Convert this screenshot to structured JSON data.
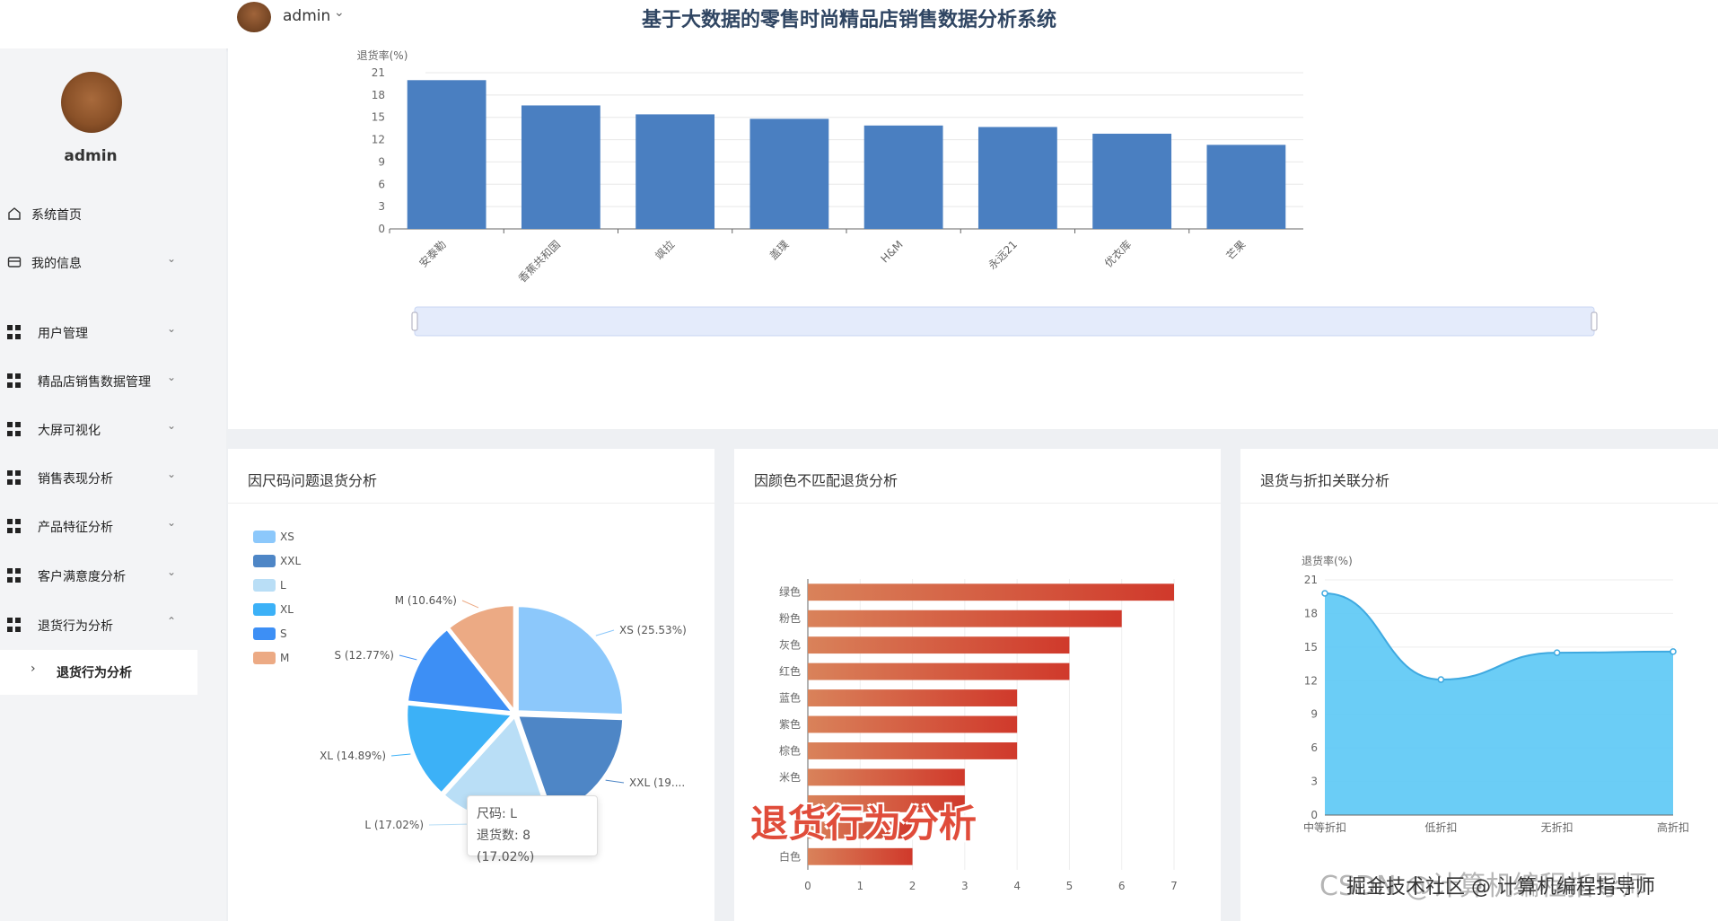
{
  "header": {
    "username": "admin",
    "title": "基于大数据的零售时尚精品店销售数据分析系统"
  },
  "sidebar": {
    "username": "admin",
    "items": [
      {
        "label": "系统首页",
        "icon": "home-icon"
      },
      {
        "label": "我的信息",
        "icon": "card-icon"
      },
      {
        "label": "用户管理",
        "icon": "grid-icon"
      },
      {
        "label": "精品店销售数据管理",
        "icon": "grid-icon"
      },
      {
        "label": "大屏可视化",
        "icon": "grid-icon"
      },
      {
        "label": "销售表现分析",
        "icon": "grid-icon"
      },
      {
        "label": "产品特征分析",
        "icon": "grid-icon"
      },
      {
        "label": "客户满意度分析",
        "icon": "grid-icon"
      },
      {
        "label": "退货行为分析",
        "icon": "grid-icon"
      }
    ],
    "sub_item": "退货行为分析"
  },
  "panels": {
    "size": "因尺码问题退货分析",
    "color": "因颜色不匹配退货分析",
    "discount": "退货与折扣关联分析"
  },
  "overlay_text": "退货行为分析",
  "watermark": "CSDN @计算机编程指导师",
  "watermark_front": "掘金技术社区 @ 计算机编程指导师",
  "tooltip": {
    "line1": "尺码: L",
    "line2": "退货数: 8 (17.02%)"
  },
  "chart_data": [
    {
      "type": "bar",
      "ylabel": "退货率(%)",
      "categories": [
        "安泰勒",
        "香蕉共和国",
        "飒拉",
        "盖璞",
        "H&M",
        "永远21",
        "优衣库",
        "芒果"
      ],
      "values": [
        20.0,
        16.6,
        15.4,
        14.8,
        13.9,
        13.7,
        12.8,
        11.3
      ],
      "ylim": [
        0,
        21
      ],
      "yticks": [
        "0",
        "3",
        "6",
        "9",
        "12",
        "15",
        "18",
        "21"
      ],
      "color": "#4a7fc1"
    },
    {
      "type": "pie",
      "legend": [
        "XS",
        "XXL",
        "L",
        "XL",
        "S",
        "M"
      ],
      "slices": [
        {
          "name": "XS",
          "value": 25.53,
          "label": "XS (25.53%)",
          "color": "#8cc8fb"
        },
        {
          "name": "XXL",
          "value": 19.15,
          "label": "XXL (19....",
          "color": "#4e86c6"
        },
        {
          "name": "L",
          "value": 17.02,
          "label": "L (17.02%)",
          "color": "#b9def6"
        },
        {
          "name": "XL",
          "value": 14.89,
          "label": "XL (14.89%)",
          "color": "#3cb1f7"
        },
        {
          "name": "S",
          "value": 12.77,
          "label": "S (12.77%)",
          "color": "#3d8ff5"
        },
        {
          "name": "M",
          "value": 10.64,
          "label": "M (10.64%)",
          "color": "#ecaa84"
        }
      ]
    },
    {
      "type": "bar",
      "orientation": "horizontal",
      "categories": [
        "绿色",
        "粉色",
        "灰色",
        "红色",
        "蓝色",
        "紫色",
        "棕色",
        "米色",
        "",
        "",
        "白色"
      ],
      "values": [
        7,
        6,
        5,
        5,
        4,
        4,
        4,
        3,
        3,
        2,
        2
      ],
      "xlim": [
        0,
        7
      ],
      "xticks": [
        "0",
        "1",
        "2",
        "3",
        "4",
        "5",
        "6",
        "7"
      ]
    },
    {
      "type": "area",
      "ylabel": "退货率(%)",
      "categories": [
        "中等折扣",
        "低折扣",
        "无折扣",
        "高折扣"
      ],
      "values": [
        19.8,
        12.1,
        14.5,
        14.6
      ],
      "ylim": [
        0,
        21
      ],
      "yticks": [
        "0",
        "3",
        "6",
        "9",
        "12",
        "15",
        "18",
        "21"
      ],
      "color": "#5bc8f5"
    }
  ]
}
